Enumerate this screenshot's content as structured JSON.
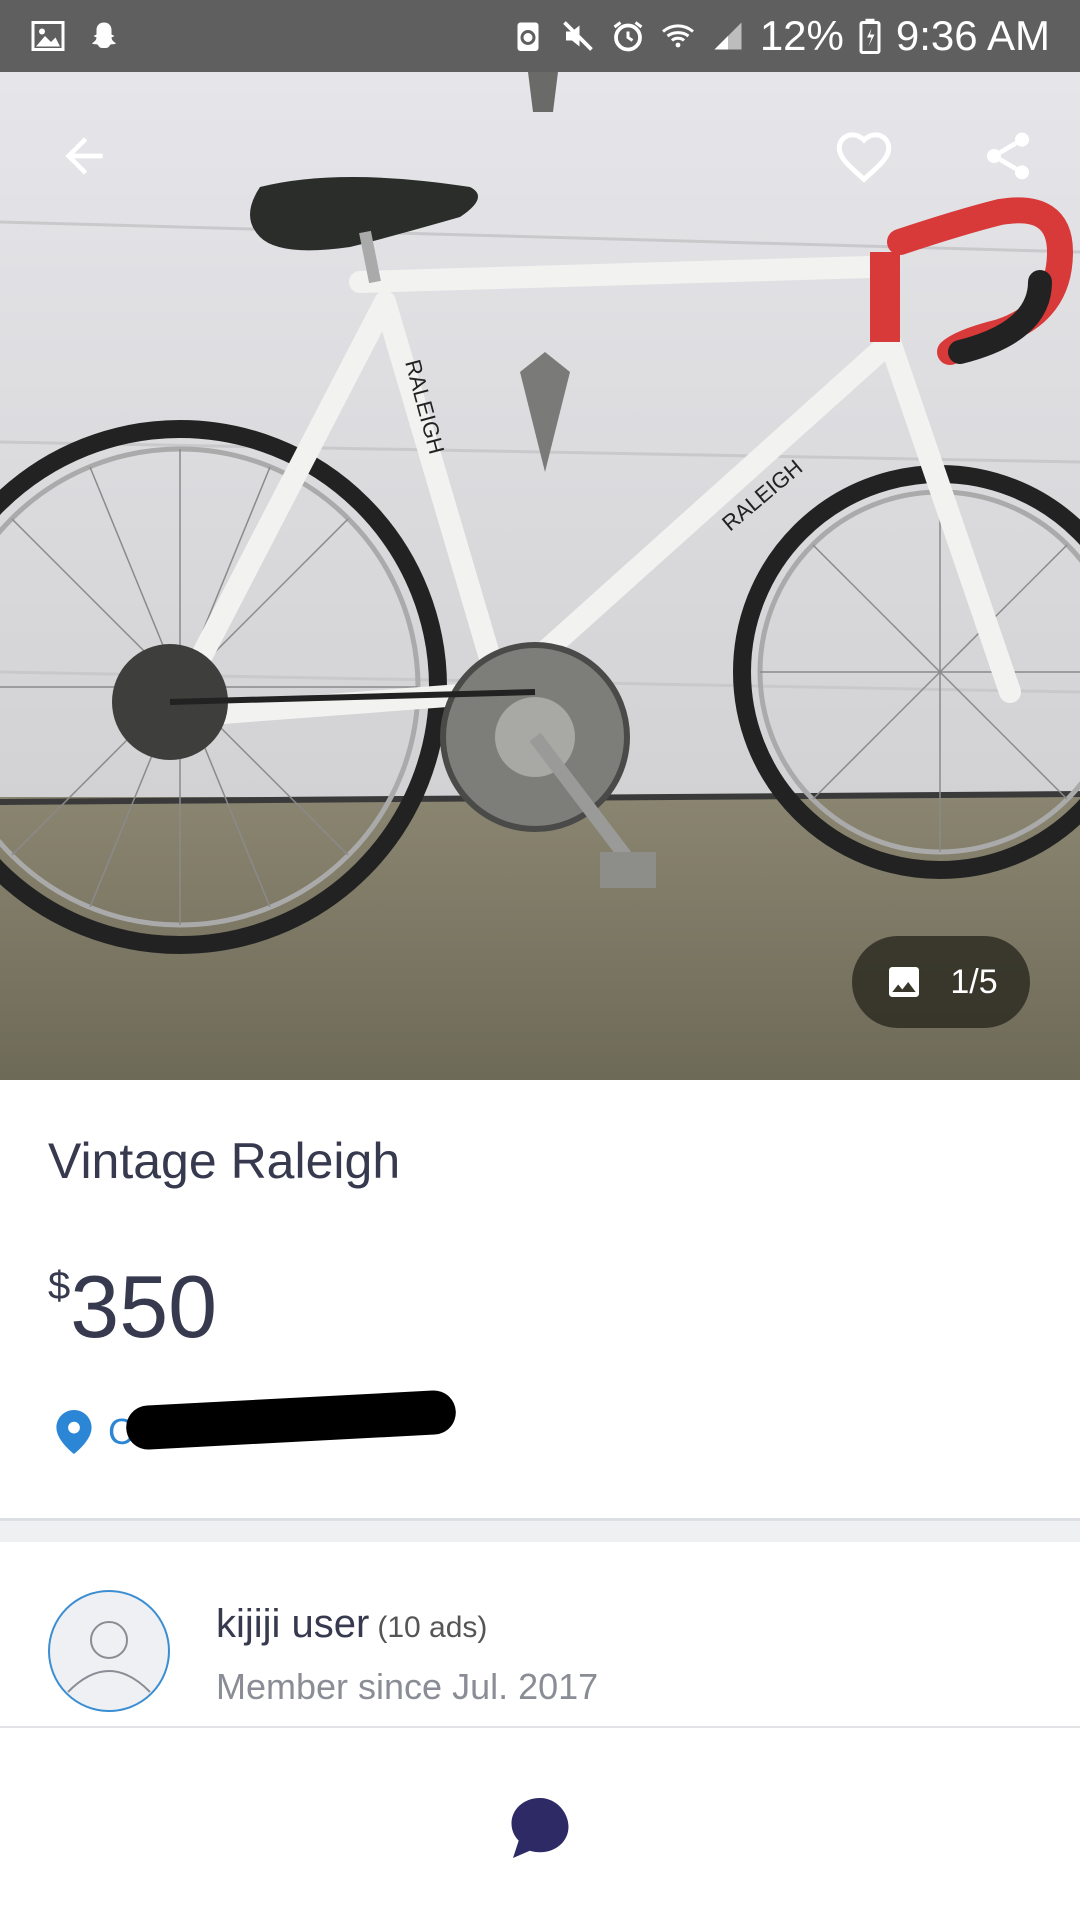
{
  "status_bar": {
    "battery": "12%",
    "time": "9:36 AM",
    "icons": [
      "gallery-icon",
      "snapchat-icon",
      "recycle-icon",
      "mute-icon",
      "alarm-icon",
      "wifi-icon",
      "signal-icon",
      "battery-icon"
    ]
  },
  "gallery": {
    "counter": "1/5",
    "icons": [
      "back-arrow-icon",
      "heart-icon",
      "share-icon",
      "image-icon"
    ]
  },
  "listing": {
    "title": "Vintage Raleigh",
    "currency": "$",
    "price": "350",
    "location": "C",
    "location_redacted": true
  },
  "seller": {
    "name": "kijiji user",
    "ads": "(10 ads)",
    "member_since": "Member since Jul. 2017"
  },
  "bottom_bar": {
    "icons": [
      "chat-icon"
    ]
  },
  "colors": {
    "accent": "#2b86d6",
    "text": "#373a4f",
    "chat": "#2d2a66"
  }
}
